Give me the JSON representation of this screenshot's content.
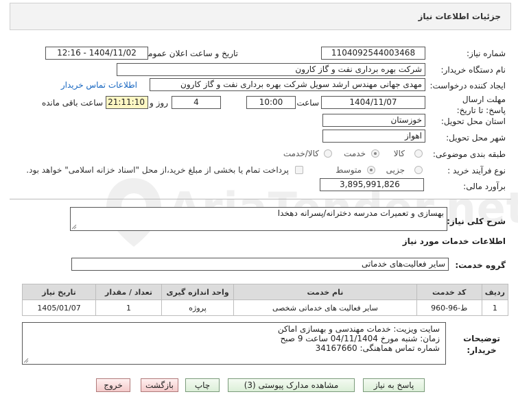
{
  "panel": {
    "title": "جزئیات اطلاعات نیاز"
  },
  "fields": {
    "need_number": {
      "label": "شماره نیاز:",
      "value": "1104092544003468"
    },
    "announce_datetime": {
      "label": "تاریخ و ساعت اعلان عمومی:",
      "value": "1404/11/02 - 12:16"
    },
    "buyer_org": {
      "label": "نام دستگاه خریدار:",
      "value": "شرکت بهره برداری نفت و گاز کارون"
    },
    "requester": {
      "label": "ایجاد کننده درخواست:",
      "value": "مهدی جهانی مهندس ارشد سویل شرکت بهره برداری نفت و گاز کارون"
    },
    "buyer_contact_link": "اطلاعات تماس خریدار",
    "deadline": {
      "label": "مهلت ارسال پاسخ: تا تاریخ:",
      "date": "1404/11/07",
      "time_label": "ساعت",
      "time": "10:00",
      "days": "4",
      "days_label": "روز و",
      "remaining": "21:11:10",
      "remaining_label": "ساعت باقی مانده"
    },
    "province": {
      "label": "استان محل تحویل:",
      "value": "خوزستان"
    },
    "city": {
      "label": "شهر محل تحویل:",
      "value": "اهواز"
    },
    "category": {
      "label": "طبقه بندی موضوعی:",
      "options": [
        "کالا",
        "خدمت",
        "کالا/خدمت"
      ],
      "selected": "خدمت"
    },
    "purchase_type": {
      "label": "نوع فرآیند خرید :",
      "options": [
        "جزیی",
        "متوسط"
      ],
      "selected": "متوسط",
      "note": "پرداخت تمام یا بخشی از مبلغ خرید،از محل \"اسناد خزانه اسلامی\" خواهد بود."
    },
    "estimate": {
      "label": "برآورد مالی:",
      "value": "3,895,991,826"
    }
  },
  "summary": {
    "label": "شرح کلی نیاز:",
    "value": "بهسازی و تعمیرات مدرسه دخترانه/پسرانه دهخدا"
  },
  "services_section": {
    "title": "اطلاعات خدمات مورد نیاز"
  },
  "service_group": {
    "label": "گروه خدمت:",
    "value": "سایر فعالیت‌های خدماتی"
  },
  "table": {
    "headers": [
      "ردیف",
      "کد خدمت",
      "نام خدمت",
      "واحد اندازه گیری",
      "تعداد / مقدار",
      "تاریخ نیاز"
    ],
    "rows": [
      [
        "1",
        "ط-96-960",
        "سایر فعالیت های خدماتی شخصی",
        "پروژه",
        "1",
        "1405/01/07"
      ]
    ]
  },
  "buyer_notes": {
    "label": "توضیحات خریدار:",
    "lines": [
      "سایت ویزیت: خدمات مهندسی و بهسازی اماکن",
      "زمان: شنبه مورخ 04/11/1404 ساعت 9 صبح",
      "شماره تماس هماهنگی: 34167660"
    ]
  },
  "buttons": {
    "reply": "پاسخ به نیاز",
    "attachments": "مشاهده مدارک پیوستی (3)",
    "print": "چاپ",
    "back": "بازگشت",
    "exit": "خروج"
  },
  "watermark": {
    "text": "AriaTender.net"
  },
  "colors": {
    "panel_bg": "#f3f3f3",
    "button_green": "#dcefd8",
    "button_red": "#f4caca",
    "remaining_bg": "#fdf7c3",
    "link": "#1565c0"
  }
}
